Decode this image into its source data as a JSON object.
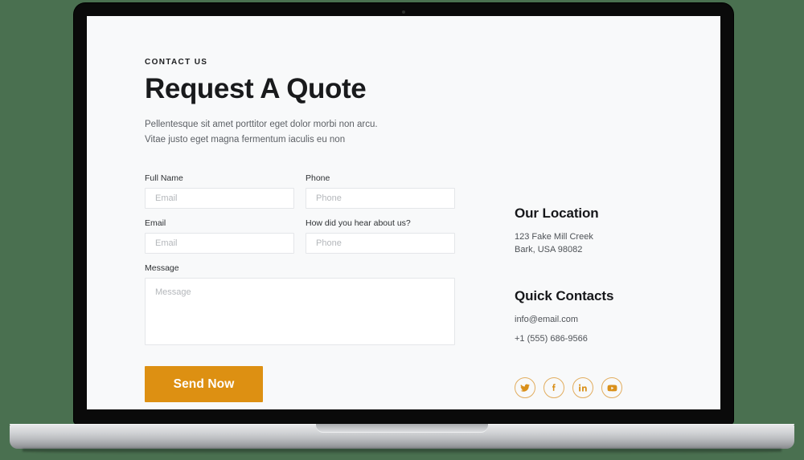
{
  "device": {
    "type": "laptop-mockup",
    "background_color": "#4a7050",
    "screen_background": "#f8f9fa",
    "bezel_color": "#0a0a0a",
    "base_color": "#c8cacd"
  },
  "page": {
    "eyebrow": "CONTACT US",
    "title": "Request A Quote",
    "intro_line_1": "Pellentesque sit amet porttitor eget dolor morbi non arcu.",
    "intro_line_2": "Vitae justo eget magna fermentum iaculis eu non",
    "accent_color": "#dd9012"
  },
  "form": {
    "fields": [
      {
        "label": "Full Name",
        "placeholder": "Email",
        "value": ""
      },
      {
        "label": "Phone",
        "placeholder": "Phone",
        "value": ""
      },
      {
        "label": "Email",
        "placeholder": "Email",
        "value": ""
      },
      {
        "label": "How did you hear about us?",
        "placeholder": "Phone",
        "value": ""
      }
    ],
    "message": {
      "label": "Message",
      "placeholder": "Message",
      "value": ""
    },
    "submit_label": "Send Now"
  },
  "info": {
    "location": {
      "heading": "Our Location",
      "line_1": "123 Fake Mill Creek",
      "line_2": "Bark, USA 98082"
    },
    "contacts": {
      "heading": "Quick Contacts",
      "email": "info@email.com",
      "phone": "+1 (555) 686-9566"
    },
    "socials": [
      {
        "name": "twitter",
        "label": "Twitter"
      },
      {
        "name": "facebook",
        "label": "Facebook"
      },
      {
        "name": "linkedin",
        "label": "LinkedIn"
      },
      {
        "name": "youtube",
        "label": "YouTube"
      }
    ],
    "social_color": "#d9901b"
  }
}
